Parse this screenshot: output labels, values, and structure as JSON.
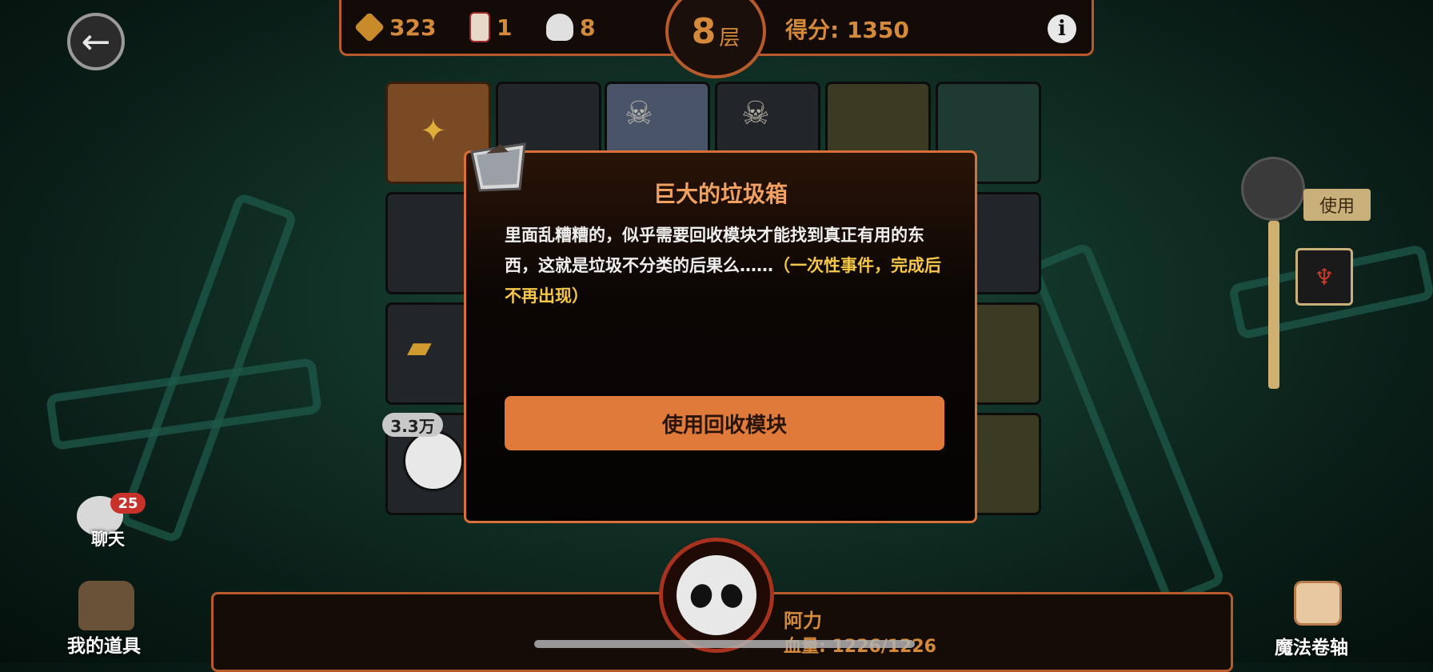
{
  "header": {
    "resources": [
      {
        "icon": "gold-ore-icon",
        "value": "323"
      },
      {
        "icon": "scroll-ticket-icon",
        "value": "1"
      },
      {
        "icon": "rice-ball-icon",
        "value": "8"
      }
    ],
    "floor_number": "8",
    "floor_unit": "层",
    "score_text": "得分: 1350",
    "info_label": "i"
  },
  "back_button": {
    "icon": "back-arrow-icon",
    "glyph": "←"
  },
  "dialog": {
    "title": "巨大的垃圾箱",
    "body": "里面乱糟糟的，似乎需要回收模块才能找到真正有用的东西，这就是垃圾不分类的后果么……",
    "note": "（一次性事件，完成后不再出现）",
    "action_label": "使用回收模块"
  },
  "right_panel": {
    "use_label": "使用"
  },
  "left_panel": {
    "chat_badge": "25",
    "chat_label": "聊天",
    "items_label": "我的道具"
  },
  "scroll_label": "魔法卷轴",
  "player": {
    "name": "阿力",
    "hp_text": "血量: 1226/1226"
  },
  "enemy_power": "3.3万",
  "colors": {
    "accent": "#d48a3a",
    "border": "#b85a2a",
    "button": "#e07a3a",
    "note": "#f5c84a"
  }
}
